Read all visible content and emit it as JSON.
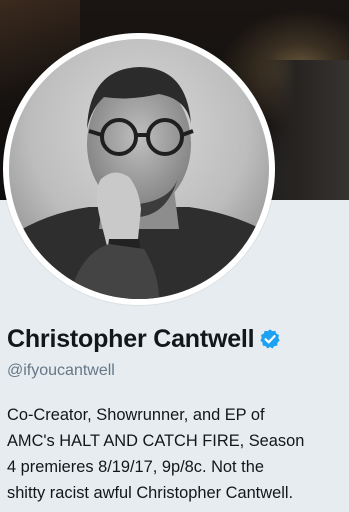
{
  "profile": {
    "display_name": "Christopher Cantwell",
    "handle": "@ifyoucantwell",
    "verified": true,
    "bio_lines": [
      "Co-Creator, Showrunner, and EP of",
      "AMC's HALT AND CATCH FIRE, Season",
      "4 premieres 8/19/17, 9p/8c. Not the",
      "shitty racist awful Christopher Cantwell."
    ]
  },
  "icons": {
    "verified": "verified-badge-icon"
  },
  "colors": {
    "background": "#e6ecf0",
    "name_text": "#14171a",
    "handle_text": "#657786",
    "verified_blue": "#1da1f2"
  }
}
